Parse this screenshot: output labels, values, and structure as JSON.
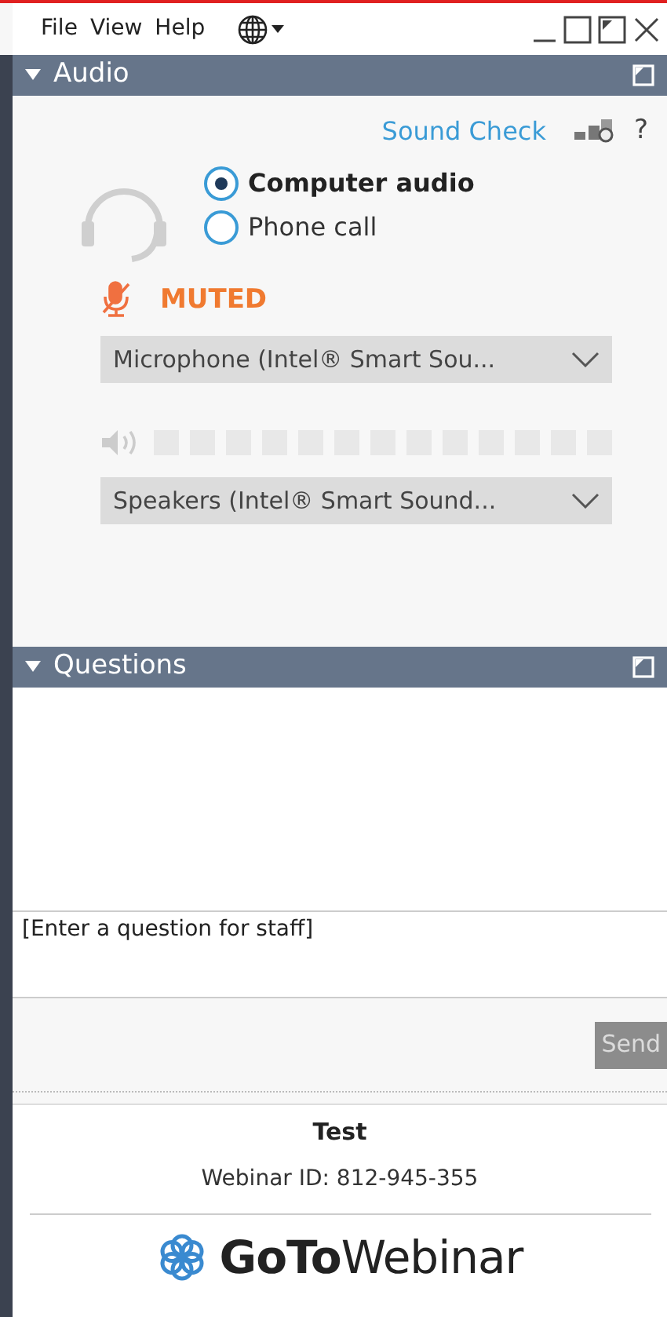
{
  "menu": [
    "File",
    "View",
    "Help"
  ],
  "audio": {
    "title": "Audio",
    "expanded": true,
    "sound_check": "Sound Check",
    "help": "?",
    "options": [
      {
        "label": "Computer audio",
        "selected": true
      },
      {
        "label": "Phone call",
        "selected": false
      }
    ],
    "mic_status": "MUTED",
    "muted": true,
    "microphone": "Microphone (Intel® Smart Sou...",
    "speaker_meter": {
      "level": 0
    },
    "speakers": "Speakers (Intel® Smart Sound..."
  },
  "questions": {
    "title": "Questions",
    "expanded": true,
    "placeholder": "[Enter a question for staff]",
    "send": "Send"
  },
  "footer": {
    "title": "Test",
    "webinar_id": "Webinar ID: 812-945-355",
    "logo": "**GoTo**Webinar"
  }
}
